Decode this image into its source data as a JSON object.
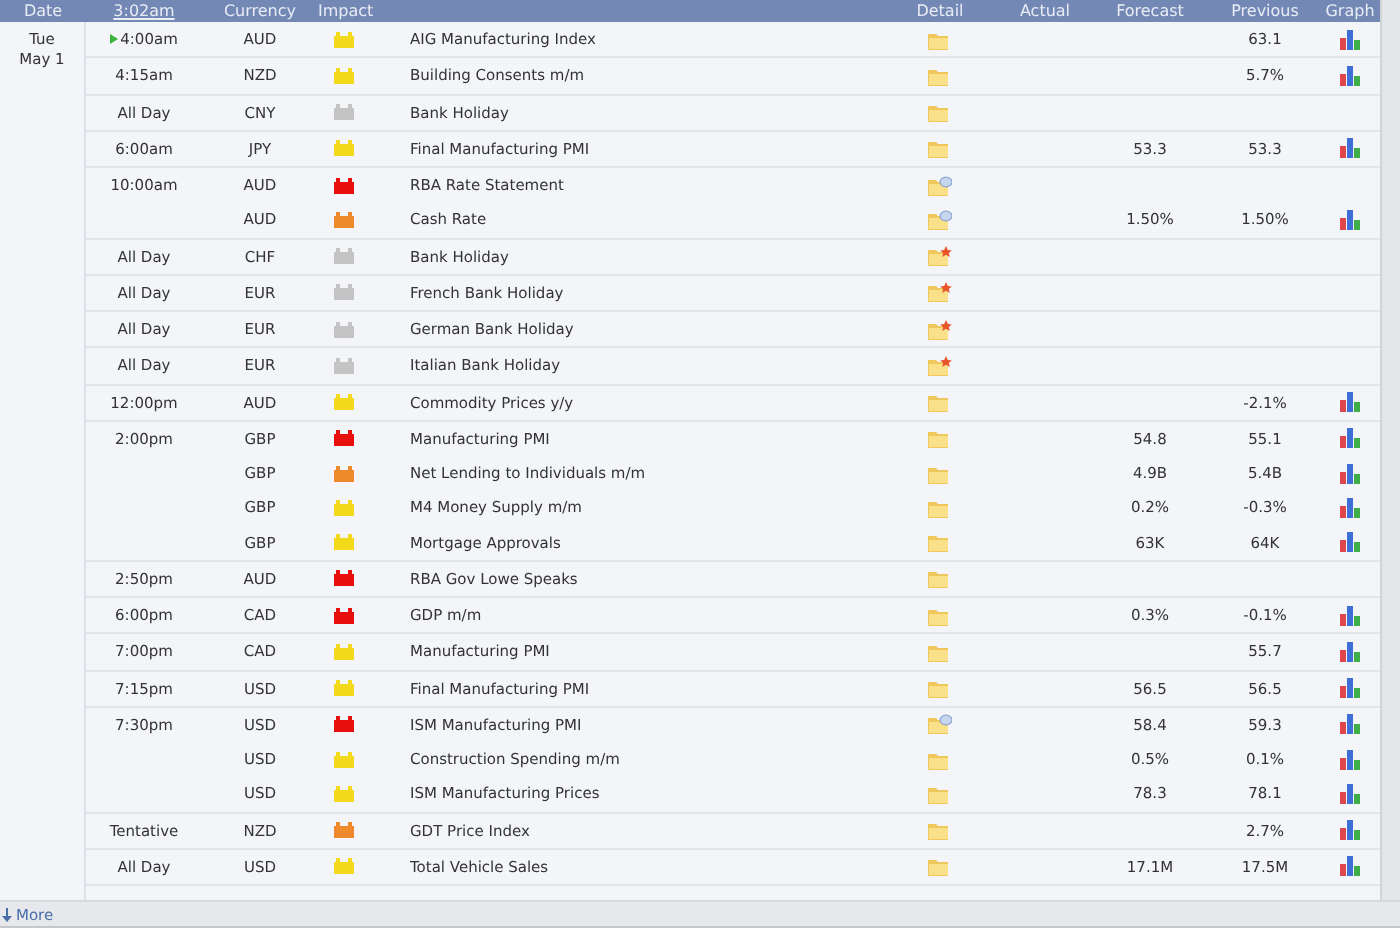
{
  "header": {
    "date": "Date",
    "time": "3:02am",
    "currency": "Currency",
    "impact": "Impact",
    "detail": "Detail",
    "actual": "Actual",
    "forecast": "Forecast",
    "previous": "Previous",
    "graph": "Graph"
  },
  "day": {
    "weekday": "Tue",
    "date": "May 1"
  },
  "slots": [
    {
      "time": "4:00am",
      "upcoming": true,
      "events": [
        {
          "currency": "AUD",
          "impact": {
            "color": "#f2d91a"
          },
          "event": "AIG Manufacturing Index",
          "detail": {
            "kind": "plain"
          },
          "previous": "63.1",
          "graph": true
        }
      ]
    },
    {
      "time": "4:15am",
      "upcoming": false,
      "events": [
        {
          "currency": "NZD",
          "impact": {
            "color": "#f2d91a"
          },
          "event": "Building Consents m/m",
          "detail": {
            "kind": "plain"
          },
          "previous": "5.7%",
          "graph": true
        }
      ]
    },
    {
      "time": "All Day",
      "upcoming": false,
      "events": [
        {
          "currency": "CNY",
          "impact": {
            "color": "#c4c4c4"
          },
          "event": "Bank Holiday",
          "detail": {
            "kind": "plain"
          },
          "graph": false
        }
      ]
    },
    {
      "time": "6:00am",
      "upcoming": false,
      "events": [
        {
          "currency": "JPY",
          "impact": {
            "color": "#f2d91a"
          },
          "event": "Final Manufacturing PMI",
          "detail": {
            "kind": "plain"
          },
          "forecast": "53.3",
          "previous": "53.3",
          "graph": true
        }
      ]
    },
    {
      "time": "10:00am",
      "upcoming": false,
      "events": [
        {
          "currency": "AUD",
          "impact": {
            "color": "#e8100f"
          },
          "event": "RBA Rate Statement",
          "detail": {
            "kind": "speech"
          },
          "graph": false
        },
        {
          "currency": "AUD",
          "impact": {
            "color": "#ef8a2c"
          },
          "event": "Cash Rate",
          "detail": {
            "kind": "speech"
          },
          "forecast": "1.50%",
          "previous": "1.50%",
          "graph": true
        }
      ]
    },
    {
      "time": "All Day",
      "upcoming": false,
      "events": [
        {
          "currency": "CHF",
          "impact": {
            "color": "#c4c4c4"
          },
          "event": "Bank Holiday",
          "detail": {
            "kind": "holiday"
          },
          "graph": false
        }
      ]
    },
    {
      "time": "All Day",
      "upcoming": false,
      "events": [
        {
          "currency": "EUR",
          "impact": {
            "color": "#c4c4c4"
          },
          "event": "French Bank Holiday",
          "detail": {
            "kind": "holiday"
          },
          "graph": false
        }
      ]
    },
    {
      "time": "All Day",
      "upcoming": false,
      "events": [
        {
          "currency": "EUR",
          "impact": {
            "color": "#c4c4c4"
          },
          "event": "German Bank Holiday",
          "detail": {
            "kind": "holiday"
          },
          "graph": false
        }
      ]
    },
    {
      "time": "All Day",
      "upcoming": false,
      "events": [
        {
          "currency": "EUR",
          "impact": {
            "color": "#c4c4c4"
          },
          "event": "Italian Bank Holiday",
          "detail": {
            "kind": "holiday"
          },
          "graph": false
        }
      ]
    },
    {
      "time": "12:00pm",
      "upcoming": false,
      "events": [
        {
          "currency": "AUD",
          "impact": {
            "color": "#f2d91a"
          },
          "event": "Commodity Prices y/y",
          "detail": {
            "kind": "plain"
          },
          "previous": "-2.1%",
          "graph": true
        }
      ]
    },
    {
      "time": "2:00pm",
      "upcoming": false,
      "events": [
        {
          "currency": "GBP",
          "impact": {
            "color": "#e8100f"
          },
          "event": "Manufacturing PMI",
          "detail": {
            "kind": "plain"
          },
          "forecast": "54.8",
          "previous": "55.1",
          "graph": true
        },
        {
          "currency": "GBP",
          "impact": {
            "color": "#ef8a2c"
          },
          "event": "Net Lending to Individuals m/m",
          "detail": {
            "kind": "plain"
          },
          "forecast": "4.9B",
          "previous": "5.4B",
          "graph": true
        },
        {
          "currency": "GBP",
          "impact": {
            "color": "#f2d91a"
          },
          "event": "M4 Money Supply m/m",
          "detail": {
            "kind": "plain"
          },
          "forecast": "0.2%",
          "previous": "-0.3%",
          "graph": true
        },
        {
          "currency": "GBP",
          "impact": {
            "color": "#f2d91a"
          },
          "event": "Mortgage Approvals",
          "detail": {
            "kind": "plain"
          },
          "forecast": "63K",
          "previous": "64K",
          "graph": true
        }
      ]
    },
    {
      "time": "2:50pm",
      "upcoming": false,
      "events": [
        {
          "currency": "AUD",
          "impact": {
            "color": "#e8100f"
          },
          "event": "RBA Gov Lowe Speaks",
          "detail": {
            "kind": "plain"
          },
          "graph": false
        }
      ]
    },
    {
      "time": "6:00pm",
      "upcoming": false,
      "events": [
        {
          "currency": "CAD",
          "impact": {
            "color": "#e8100f"
          },
          "event": "GDP m/m",
          "detail": {
            "kind": "plain"
          },
          "forecast": "0.3%",
          "previous": "-0.1%",
          "graph": true
        }
      ]
    },
    {
      "time": "7:00pm",
      "upcoming": false,
      "events": [
        {
          "currency": "CAD",
          "impact": {
            "color": "#f2d91a"
          },
          "event": "Manufacturing PMI",
          "detail": {
            "kind": "plain"
          },
          "previous": "55.7",
          "graph": true
        }
      ]
    },
    {
      "time": "7:15pm",
      "upcoming": false,
      "events": [
        {
          "currency": "USD",
          "impact": {
            "color": "#f2d91a"
          },
          "event": "Final Manufacturing PMI",
          "detail": {
            "kind": "plain"
          },
          "forecast": "56.5",
          "previous": "56.5",
          "graph": true
        }
      ]
    },
    {
      "time": "7:30pm",
      "upcoming": false,
      "events": [
        {
          "currency": "USD",
          "impact": {
            "color": "#e8100f"
          },
          "event": "ISM Manufacturing PMI",
          "detail": {
            "kind": "speech"
          },
          "forecast": "58.4",
          "previous": "59.3",
          "graph": true
        },
        {
          "currency": "USD",
          "impact": {
            "color": "#f2d91a"
          },
          "event": "Construction Spending m/m",
          "detail": {
            "kind": "plain"
          },
          "forecast": "0.5%",
          "previous": "0.1%",
          "graph": true
        },
        {
          "currency": "USD",
          "impact": {
            "color": "#f2d91a"
          },
          "event": "ISM Manufacturing Prices",
          "detail": {
            "kind": "plain"
          },
          "forecast": "78.3",
          "previous": "78.1",
          "graph": true
        }
      ]
    },
    {
      "time": "Tentative",
      "upcoming": false,
      "events": [
        {
          "currency": "NZD",
          "impact": {
            "color": "#ef8a2c"
          },
          "event": "GDT Price Index",
          "detail": {
            "kind": "plain"
          },
          "previous": "2.7%",
          "graph": true
        }
      ]
    },
    {
      "time": "All Day",
      "upcoming": false,
      "events": [
        {
          "currency": "USD",
          "impact": {
            "color": "#f2d91a"
          },
          "event": "Total Vehicle Sales",
          "detail": {
            "kind": "plain"
          },
          "forecast": "17.1M",
          "previous": "17.5M",
          "graph": true
        }
      ]
    }
  ],
  "footer": {
    "more": "More"
  }
}
